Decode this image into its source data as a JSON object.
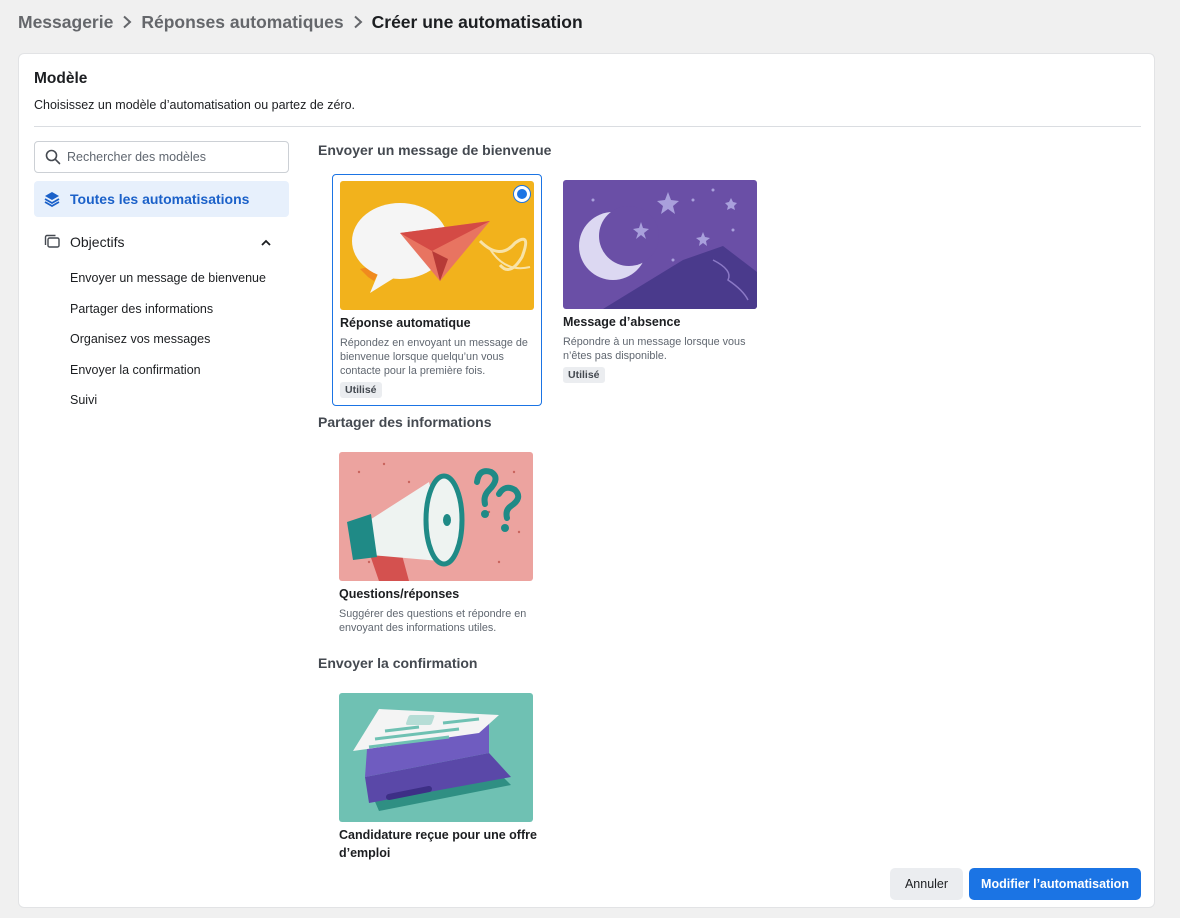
{
  "breadcrumb": {
    "items": [
      "Messagerie",
      "Réponses automatiques",
      "Créer une automatisation"
    ]
  },
  "panel": {
    "title": "Modèle",
    "subtitle": "Choisissez un modèle d’automatisation ou partez de zéro."
  },
  "sidebar": {
    "search_placeholder": "Rechercher des modèles",
    "all_label": "Toutes les automatisations",
    "objectives_label": "Objectifs",
    "objectives": [
      "Envoyer un message de bienvenue",
      "Partager des informations",
      "Organisez vos messages",
      "Envoyer la confirmation",
      "Suivi"
    ]
  },
  "sections": [
    {
      "heading": "Envoyer un message de bienvenue",
      "cards": [
        {
          "title": "Réponse automatique",
          "desc_lines": [
            "Répondez en envoyant un message de",
            "bienvenue lorsque quelqu’un vous",
            "contacte pour la première fois."
          ],
          "badge": "Utilisé",
          "selected": true
        },
        {
          "title": "Message d’absence",
          "desc_lines": [
            "Répondre à un message lorsque vous",
            "n’êtes pas disponible."
          ],
          "badge": "Utilisé",
          "selected": false
        }
      ]
    },
    {
      "heading": "Partager des informations",
      "cards": [
        {
          "title": "Questions/réponses",
          "desc_lines": [
            "Suggérer des questions et répondre en",
            "envoyant des informations utiles."
          ]
        }
      ]
    },
    {
      "heading": "Envoyer la confirmation",
      "cards": [
        {
          "title_lines": [
            "Candidature reçue pour une offre",
            "d’emploi"
          ]
        }
      ]
    }
  ],
  "footer": {
    "cancel_label": "Annuler",
    "primary_label": "Modifier l’automatisation"
  },
  "colors": {
    "accent": "#1b74e4",
    "nav_active_bg": "#e7f0fc",
    "thumb_welcome": "#f2b21c",
    "thumb_away": "#6a4fa6",
    "thumb_qa": "#eca39f",
    "thumb_confirm": "#6fc1b3"
  }
}
